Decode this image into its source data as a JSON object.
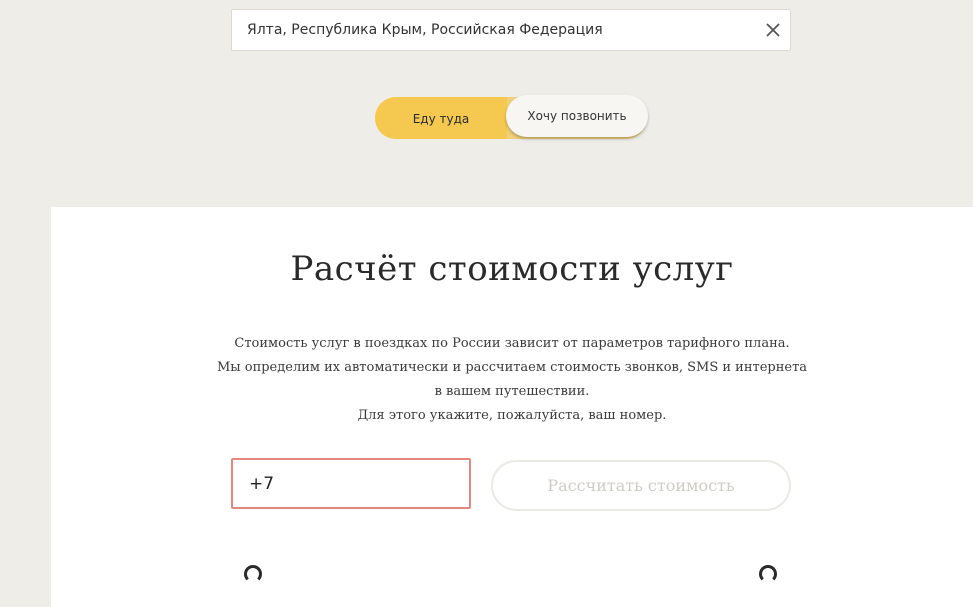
{
  "search": {
    "value": "Ялта, Республика Крым, Российская Федерация",
    "clear_icon": "close-icon"
  },
  "toggle": {
    "options": [
      "Еду туда",
      "Хочу позвонить"
    ],
    "selected": "Еду туда"
  },
  "card": {
    "title": "Расчёт стоимости услуг",
    "description_lines": [
      "Стоимость услуг в поездках по России зависит от параметров тарифного плана.",
      "Мы определим их автоматически и рассчитаем стоимость звонков, SMS и интернета",
      "в вашем путешествии.",
      "Для этого укажите, пожалуйста, ваш номер."
    ],
    "phone": {
      "value": "+7",
      "border_color": "#e4877c"
    },
    "calculate_label": "Рассчитать стоимость"
  },
  "colors": {
    "background": "#efede8",
    "toggle_active": "#f5c94f",
    "button_disabled_text": "#cfccc6"
  }
}
